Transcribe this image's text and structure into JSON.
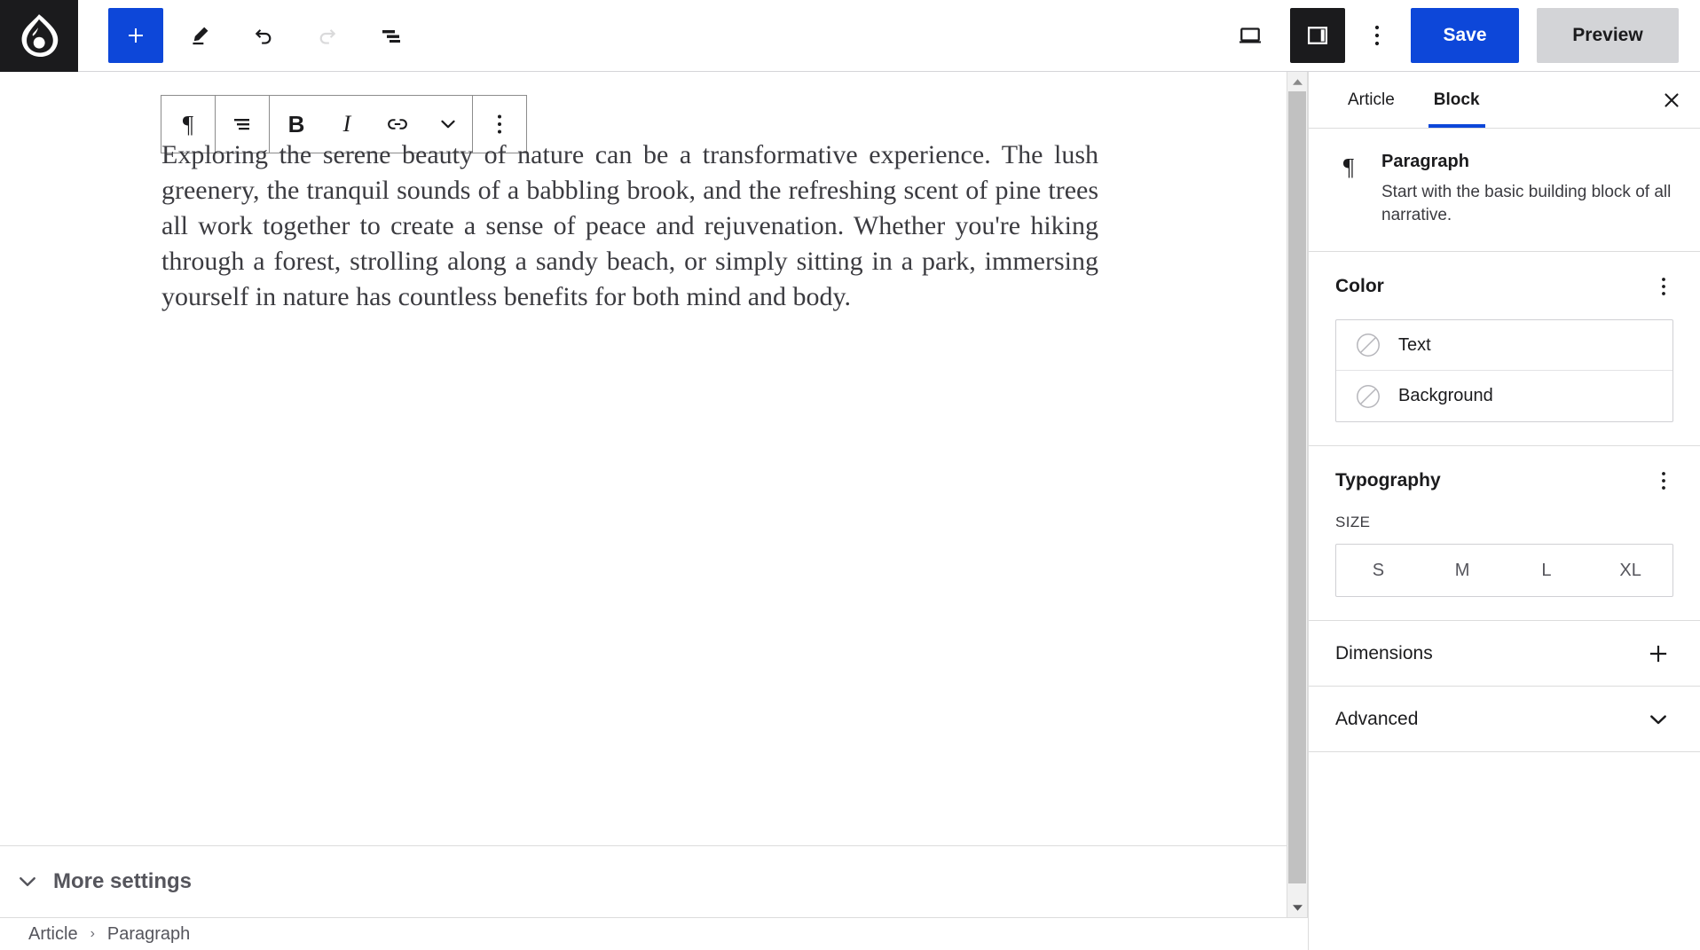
{
  "topbar": {
    "logo_icon": "drupal-drop-icon",
    "add_button_label": "+",
    "tools": [
      {
        "name": "edit-pencil-icon",
        "label": "Edit"
      },
      {
        "name": "undo-icon",
        "label": "Undo"
      },
      {
        "name": "redo-icon",
        "label": "Redo"
      },
      {
        "name": "document-outline-icon",
        "label": "Document overview"
      }
    ],
    "preview_device_icon": "desktop-preview-icon",
    "sidebar_toggle_icon": "sidebar-panel-icon",
    "more_menu_icon": "vertical-ellipsis-icon",
    "save_label": "Save",
    "preview_label": "Preview",
    "accent_blue": "#0d47d9",
    "dark": "#1b1b1d",
    "preview_grey": "#d3d4d7"
  },
  "block_toolbar": {
    "buttons": [
      {
        "name": "paragraph-type-icon",
        "glyph": "¶",
        "label": "Paragraph"
      },
      {
        "name": "align-text-icon",
        "glyph": "",
        "label": "Align text"
      },
      {
        "name": "bold-button",
        "glyph": "B",
        "label": "Bold"
      },
      {
        "name": "italic-button",
        "glyph": "I",
        "label": "Italic"
      },
      {
        "name": "link-button",
        "glyph": "",
        "label": "Link"
      },
      {
        "name": "chevron-down-icon",
        "glyph": "",
        "label": "More rich text controls"
      },
      {
        "name": "block-options-icon",
        "glyph": "",
        "label": "Options"
      }
    ]
  },
  "editor": {
    "paragraph_text": "Exploring the serene beauty of nature can be a transformative experience. The lush greenery, the tranquil sounds of a babbling brook, and the refreshing scent of pine trees all work together to create a sense of peace and rejuvenation. Whether you're hiking through a forest, strolling along a sandy beach, or simply sitting in a park, immersing yourself in nature has countless benefits for both mind and body."
  },
  "more_settings": {
    "label": "More settings",
    "chevron_icon": "chevron-down-icon"
  },
  "breadcrumb": {
    "items": [
      "Article",
      "Paragraph"
    ],
    "separator": "›"
  },
  "sidebar": {
    "tabs": [
      {
        "label": "Article",
        "active": false
      },
      {
        "label": "Block",
        "active": true
      }
    ],
    "close_icon": "close-icon",
    "block_card": {
      "icon": "paragraph-icon",
      "glyph": "¶",
      "title": "Paragraph",
      "description": "Start with the basic building block of all narrative."
    },
    "color": {
      "title": "Color",
      "kebab_icon": "vertical-ellipsis-icon",
      "options": [
        {
          "label": "Text",
          "swatch_icon": "empty-swatch-icon"
        },
        {
          "label": "Background",
          "swatch_icon": "empty-swatch-icon"
        }
      ]
    },
    "typography": {
      "title": "Typography",
      "kebab_icon": "vertical-ellipsis-icon",
      "size_label": "SIZE",
      "sizes": [
        "S",
        "M",
        "L",
        "XL"
      ],
      "selected_size": ""
    },
    "dimensions": {
      "title": "Dimensions",
      "action_icon": "plus-icon"
    },
    "advanced": {
      "title": "Advanced",
      "action_icon": "chevron-down-icon"
    },
    "active_tab_underline_color": "#0d47d9"
  },
  "scrollbar": {
    "up_arrow_icon": "triangle-up-icon",
    "down_arrow_icon": "triangle-down-icon"
  }
}
